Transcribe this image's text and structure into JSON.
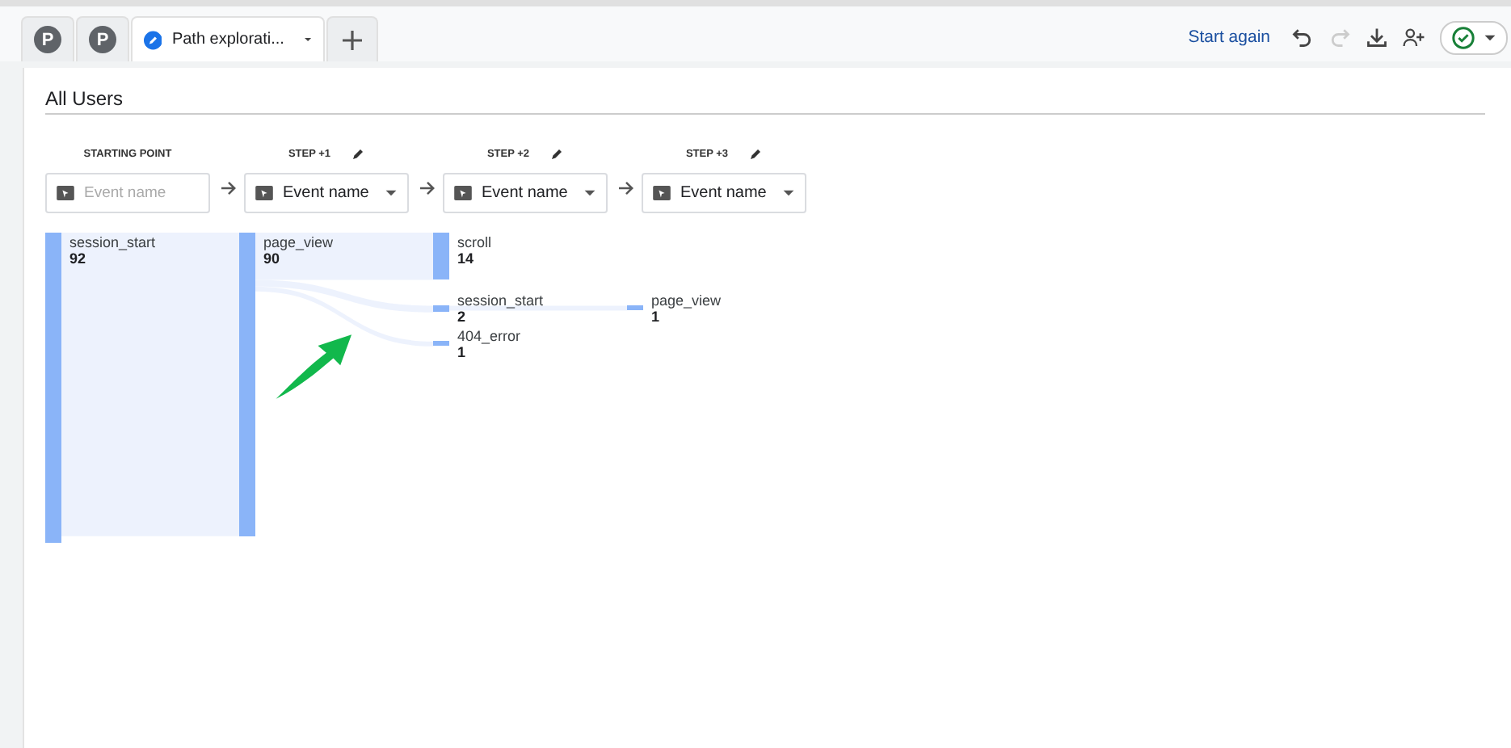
{
  "tabs": [
    {
      "kind": "avatar",
      "label": "P",
      "selected": false
    },
    {
      "kind": "avatar",
      "label": "P",
      "selected": false
    },
    {
      "kind": "exploration",
      "label": "Path explorati...",
      "selected": true
    }
  ],
  "toolbar": {
    "start_again": "Start again",
    "undo_disabled": false,
    "redo_disabled": true
  },
  "segment": "All Users",
  "steps": [
    {
      "label": "STARTING POINT",
      "editable": false,
      "placeholder": "Event name"
    },
    {
      "label": "STEP +1",
      "editable": true,
      "value": "Event name"
    },
    {
      "label": "STEP +2",
      "editable": true,
      "value": "Event name"
    },
    {
      "label": "STEP +3",
      "editable": true,
      "value": "Event name"
    }
  ],
  "tree": [
    {
      "label": "session_start",
      "count": "92",
      "children": [
        {
          "label": "page_view",
          "count": "90",
          "children": [
            {
              "label": "scroll",
              "count": "14"
            },
            {
              "label": "session_start",
              "count": "2",
              "children": [
                {
                  "label": "page_view",
                  "count": "1"
                }
              ]
            },
            {
              "label": "404_error",
              "count": "1"
            }
          ]
        }
      ]
    }
  ]
}
